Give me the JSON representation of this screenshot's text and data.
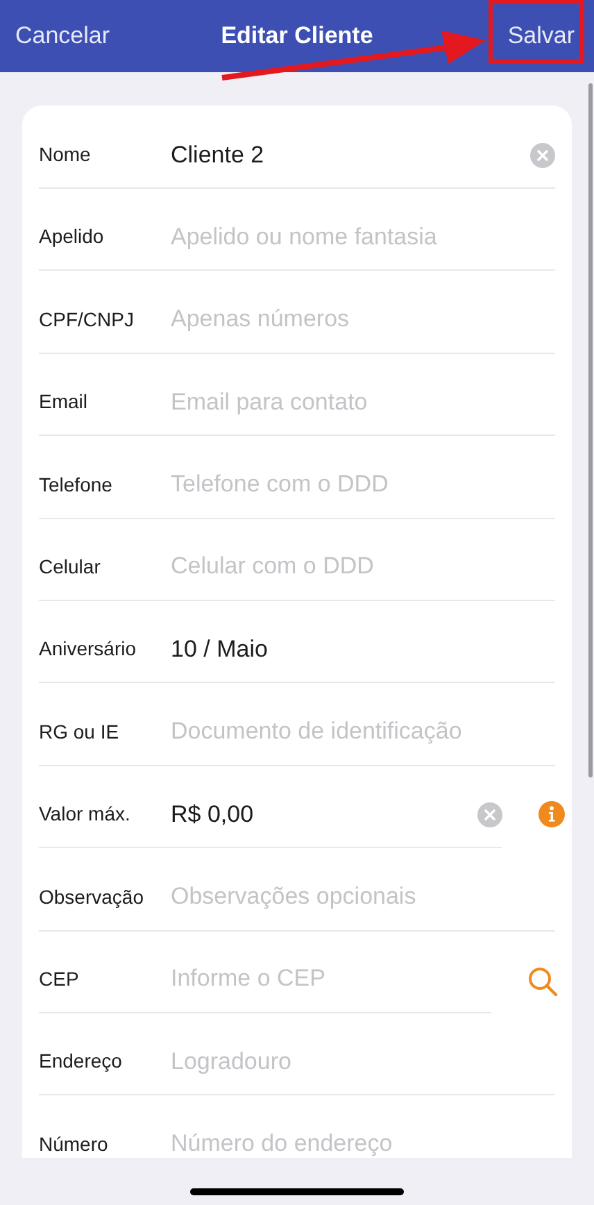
{
  "nav_bar": {
    "cancel": "Cancelar",
    "title": "Editar Cliente",
    "save": "Salvar"
  },
  "fields": [
    {
      "kind": "plain",
      "label": "Nome",
      "value": "Cliente 2",
      "clear": true
    },
    {
      "kind": "plain",
      "label": "Apelido",
      "placeholder": "Apelido ou nome fantasia"
    },
    {
      "kind": "plain",
      "label": "CPF/CNPJ",
      "placeholder": "Apenas números"
    },
    {
      "kind": "plain",
      "label": "Email",
      "placeholder": "Email para contato"
    },
    {
      "kind": "plain",
      "label": "Telefone",
      "placeholder": "Telefone com o DDD"
    },
    {
      "kind": "plain",
      "label": "Celular",
      "placeholder": "Celular com o DDD"
    },
    {
      "kind": "plain",
      "label": "Aniversário",
      "value": "10 / Maio"
    },
    {
      "kind": "plain",
      "label": "RG ou IE",
      "placeholder": "Documento de identificação"
    },
    {
      "kind": "info",
      "label": "Valor máx.",
      "value": "R$ 0,00",
      "clear": true
    },
    {
      "kind": "plain",
      "label": "Observação",
      "placeholder": "Observações opcionais"
    },
    {
      "kind": "search",
      "label": "CEP",
      "placeholder": "Informe o CEP"
    },
    {
      "kind": "plain",
      "label": "Endereço",
      "placeholder": "Logradouro"
    },
    {
      "kind": "plain",
      "label": "Número",
      "placeholder": "Número do endereço"
    }
  ]
}
